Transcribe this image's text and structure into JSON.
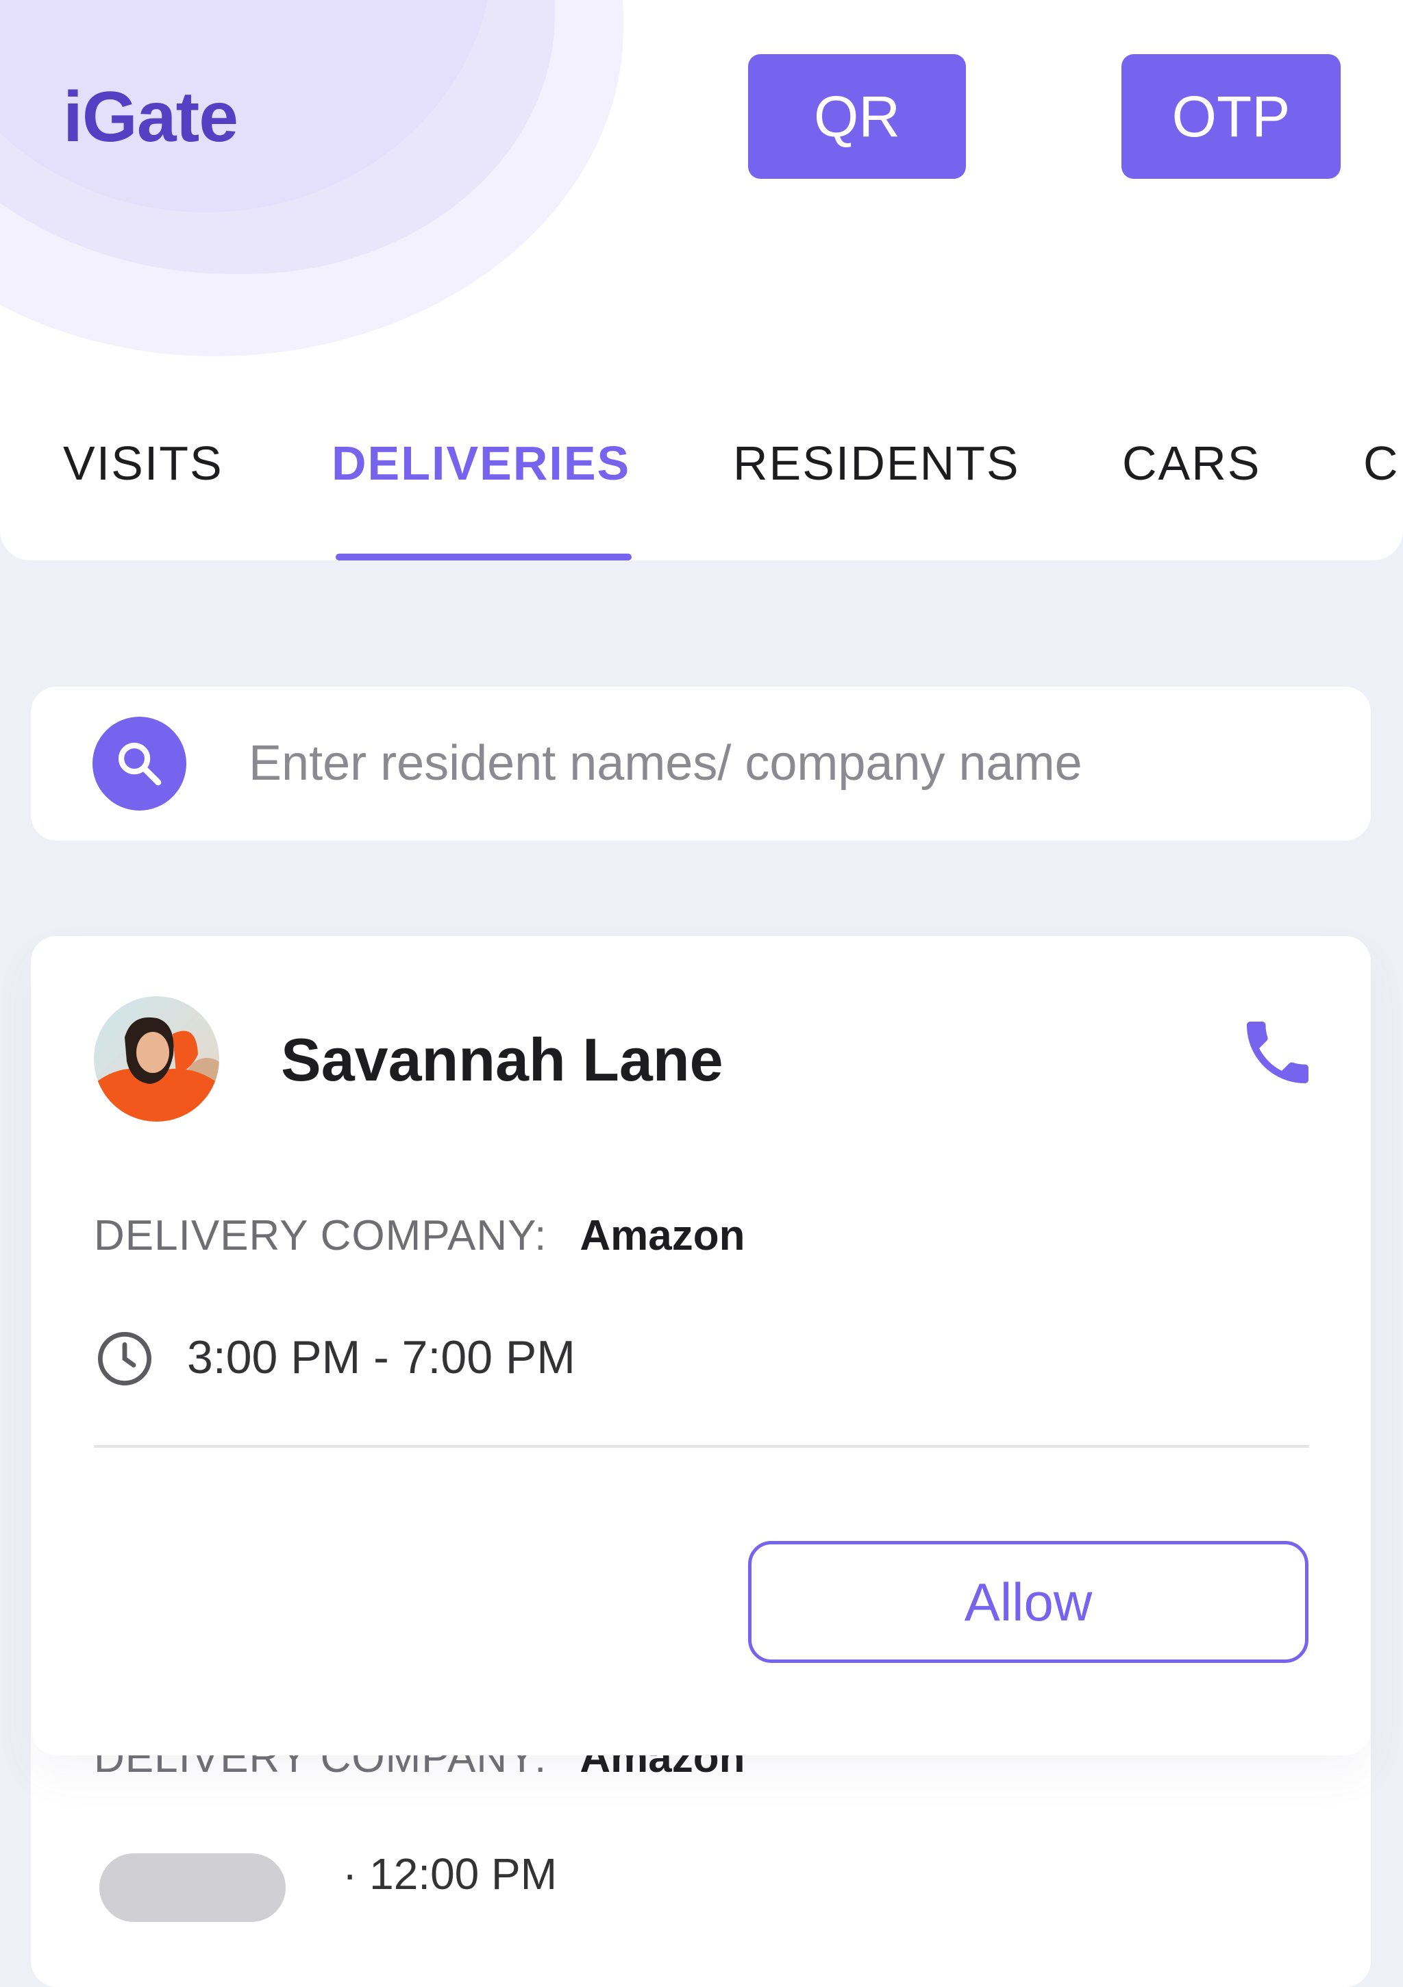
{
  "header": {
    "app_title": "iGate",
    "qr_label": "QR",
    "otp_label": "OTP"
  },
  "tabs": [
    {
      "label": "VISITS",
      "active": false
    },
    {
      "label": "DELIVERIES",
      "active": true
    },
    {
      "label": "RESIDENTS",
      "active": false
    },
    {
      "label": "CARS",
      "active": false
    },
    {
      "label": "C",
      "active": false
    }
  ],
  "search": {
    "placeholder": "Enter resident names/ company name",
    "value": "",
    "icon": "search-icon"
  },
  "deliveries": [
    {
      "resident_name": "Savannah Lane",
      "company_label": "DELIVERY COMPANY:",
      "company": "Amazon",
      "time_range": "3:00 PM - 7:00 PM",
      "action_label": "Allow",
      "call_icon": "phone-icon",
      "time_icon": "clock-icon"
    },
    {
      "company_label": "DELIVERY COMPANY:",
      "company": "Amazon",
      "time_partial": "· 12:00 PM"
    }
  ],
  "colors": {
    "accent": "#7663ee",
    "title": "#5540c4",
    "background": "#eef0f7",
    "card": "#ffffff"
  }
}
